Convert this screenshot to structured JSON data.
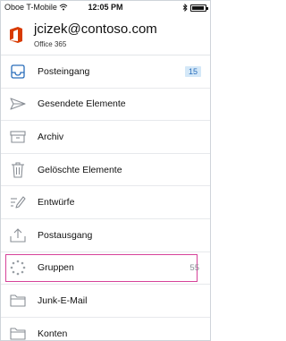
{
  "status_bar": {
    "carrier": "Oboe T-Mobile",
    "time": "12:05 PM"
  },
  "account": {
    "email": "jcizek@contoso.com",
    "subtitle": "Office 365",
    "brand_color": "#d83b01"
  },
  "folders": [
    {
      "label": "Posteingang",
      "icon": "inbox-icon",
      "badge": "15"
    },
    {
      "label": "Gesendete Elemente",
      "icon": "sent-icon"
    },
    {
      "label": "Archiv",
      "icon": "archive-icon"
    },
    {
      "label": "Gelöschte Elemente",
      "icon": "trash-icon"
    },
    {
      "label": "Entwürfe",
      "icon": "drafts-icon"
    },
    {
      "label": "Postausgang",
      "icon": "outbox-icon"
    },
    {
      "label": "Gruppen",
      "icon": "groups-icon",
      "count": "55",
      "highlighted": true
    },
    {
      "label": "Junk-E-Mail",
      "icon": "folder-icon"
    },
    {
      "label": "Konten",
      "icon": "folder-icon"
    }
  ],
  "colors": {
    "accent": "#2a6ebb",
    "badge_bg": "#d4e8f8",
    "highlight": "#d6439a",
    "icon": "#8a8f96"
  }
}
